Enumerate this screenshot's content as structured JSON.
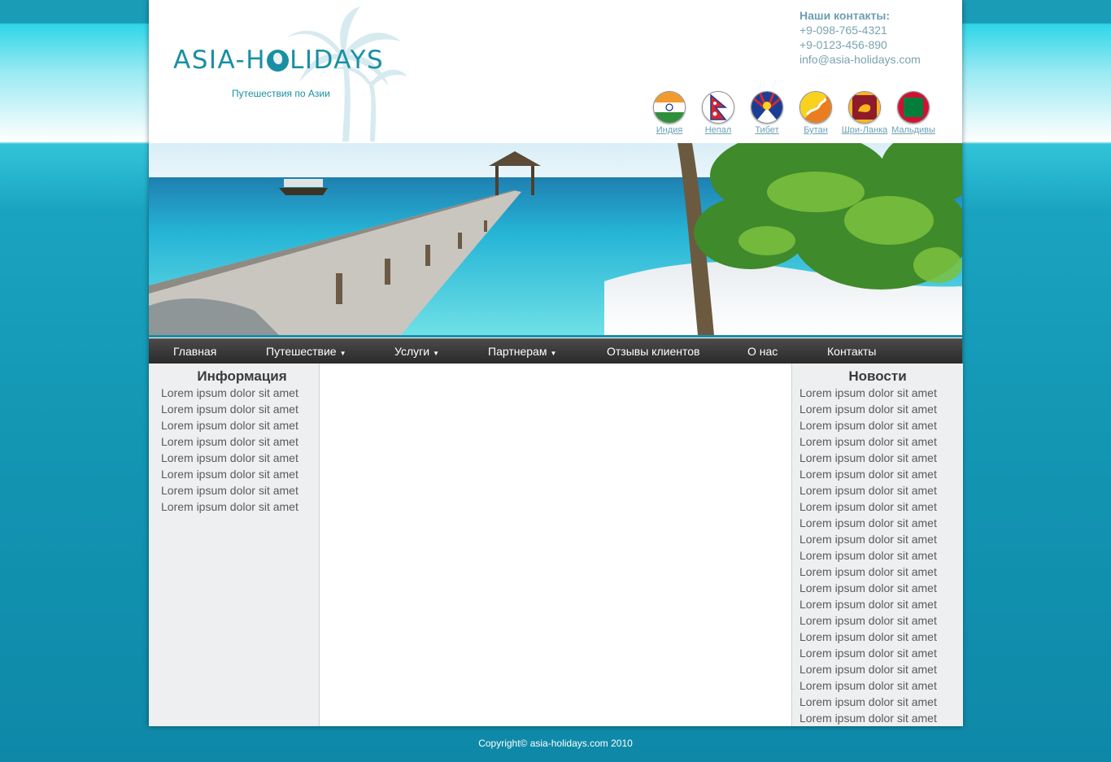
{
  "header": {
    "logo_text_left": "ASIA-H",
    "logo_text_right": "LIDAYS",
    "tagline": "Путешествия по Азии"
  },
  "contacts": {
    "title": "Наши контакты:",
    "phone1": "+9-098-765-4321",
    "phone2": "+9-0123-456-890",
    "email": "info@asia-holidays.com"
  },
  "flags": [
    {
      "label": "Индия",
      "icon": "india-flag-icon"
    },
    {
      "label": "Непал",
      "icon": "nepal-flag-icon"
    },
    {
      "label": "Тибет",
      "icon": "tibet-flag-icon"
    },
    {
      "label": "Бутан",
      "icon": "bhutan-flag-icon"
    },
    {
      "label": "Шри-Ланка",
      "icon": "sri-lanka-flag-icon"
    },
    {
      "label": "Мальдивы",
      "icon": "maldives-flag-icon"
    }
  ],
  "nav": {
    "items": [
      {
        "label": "Главная",
        "dropdown": false
      },
      {
        "label": "Путешествие",
        "dropdown": true
      },
      {
        "label": "Услуги",
        "dropdown": true
      },
      {
        "label": "Партнерам",
        "dropdown": true
      },
      {
        "label": "Отзывы клиентов",
        "dropdown": false
      },
      {
        "label": "О нас",
        "dropdown": false
      },
      {
        "label": "Контакты",
        "dropdown": false
      }
    ],
    "dropdown_arrow": "▼"
  },
  "left_column": {
    "title": "Информация",
    "items": [
      "Lorem ipsum dolor sit amet",
      "Lorem ipsum dolor sit amet",
      "Lorem ipsum dolor sit amet",
      "Lorem ipsum dolor sit amet",
      "Lorem ipsum dolor sit amet",
      "Lorem ipsum dolor sit amet",
      "Lorem ipsum dolor sit amet",
      "Lorem ipsum dolor sit amet"
    ]
  },
  "right_column": {
    "title": "Новости",
    "items": [
      "Lorem ipsum dolor sit amet",
      "Lorem ipsum dolor sit amet",
      "Lorem ipsum dolor sit amet",
      "Lorem ipsum dolor sit amet",
      "Lorem ipsum dolor sit amet",
      "Lorem ipsum dolor sit amet",
      "Lorem ipsum dolor sit amet",
      "Lorem ipsum dolor sit amet",
      "Lorem ipsum dolor sit amet",
      "Lorem ipsum dolor sit amet",
      "Lorem ipsum dolor sit amet",
      "Lorem ipsum dolor sit amet",
      "Lorem ipsum dolor sit amet",
      "Lorem ipsum dolor sit amet",
      "Lorem ipsum dolor sit amet",
      "Lorem ipsum dolor sit amet",
      "Lorem ipsum dolor sit amet",
      "Lorem ipsum dolor sit amet",
      "Lorem ipsum dolor sit amet",
      "Lorem ipsum dolor sit amet",
      "Lorem ipsum dolor sit amet"
    ]
  },
  "footer": {
    "copyright": "Copyright© asia-holidays.com 2010"
  },
  "colors": {
    "brand": "#1a8fa3",
    "nav_bg": "#333333",
    "sidebar_bg": "#eeeff0",
    "page_bg": "#1397b3"
  }
}
